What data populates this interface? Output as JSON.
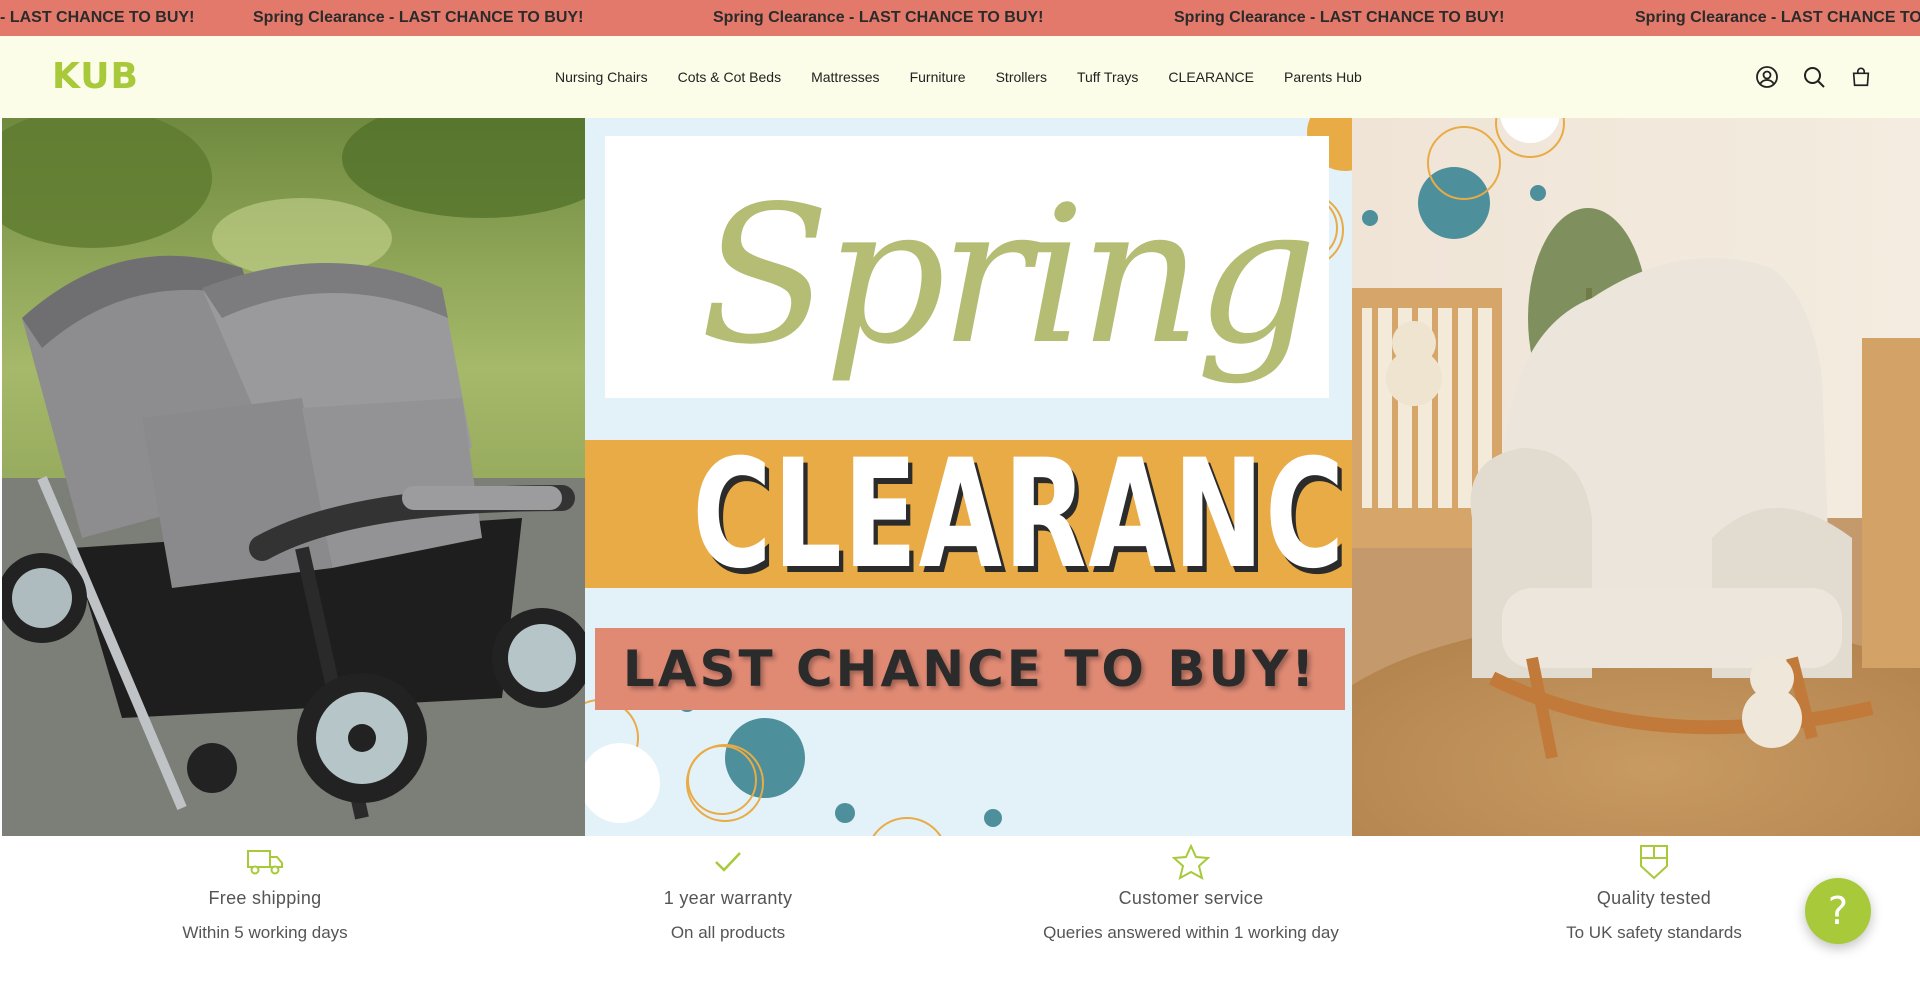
{
  "announcement": {
    "messages": [
      "Spring Clearance - LAST CHANCE TO BUY!",
      "Spring Clearance - LAST CHANCE TO BUY!",
      "Spring Clearance - LAST CHANCE TO BUY!",
      "Spring Clearance - LAST CHANCE TO BUY!",
      "Spring Clearance - LAST CHANCE TO BUY!"
    ],
    "background": "#e2796a"
  },
  "header": {
    "logo_text": "KUB",
    "nav": [
      "Nursing Chairs",
      "Cots & Cot Beds",
      "Mattresses",
      "Furniture",
      "Strollers",
      "Tuff Trays",
      "CLEARANCE",
      "Parents Hub"
    ],
    "icons": [
      "account-icon",
      "search-icon",
      "cart-icon"
    ],
    "background": "#fbfde8",
    "brand_color": "#a8c93a"
  },
  "hero": {
    "spring_text": "Spring",
    "clearance_text": "CLEARANCE",
    "last_chance_text": "LAST CHANCE TO BUY!",
    "colors": {
      "spring": "#b5bc73",
      "band": "#e9ab45",
      "cta_band": "#e08a74",
      "accent_teal": "#4e8f9c"
    }
  },
  "features": [
    {
      "icon": "truck-icon",
      "title": "Free shipping",
      "subtitle": "Within 5 working days"
    },
    {
      "icon": "check-icon",
      "title": "1 year warranty",
      "subtitle": "On all products"
    },
    {
      "icon": "star-icon",
      "title": "Customer service",
      "subtitle": "Queries answered within 1 working day"
    },
    {
      "icon": "shield-icon",
      "title": "Quality tested",
      "subtitle": "To UK safety standards"
    }
  ],
  "help": {
    "icon": "question-icon",
    "label": "?"
  }
}
